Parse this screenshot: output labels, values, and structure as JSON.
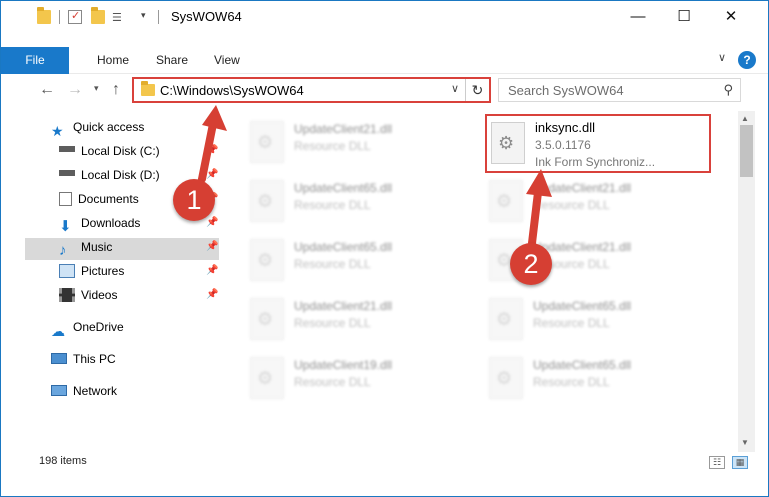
{
  "window": {
    "title": "SysWOW64",
    "minimize": "—",
    "maximize": "☐",
    "close": "✕"
  },
  "ribbon": {
    "tabs": [
      "File",
      "Home",
      "Share",
      "View"
    ],
    "help": "?"
  },
  "address": {
    "path": "C:\\Windows\\SysWOW64",
    "search_placeholder": "Search SysWOW64"
  },
  "nav": {
    "items": [
      {
        "label": "Quick access",
        "icon": "star-icon",
        "pinned": false
      },
      {
        "label": "Local Disk (C:)",
        "icon": "drive-icon",
        "pinned": true
      },
      {
        "label": "Local Disk (D:)",
        "icon": "drive-icon",
        "pinned": true
      },
      {
        "label": "Documents",
        "icon": "documents-icon",
        "pinned": true
      },
      {
        "label": "Downloads",
        "icon": "download-icon",
        "pinned": true
      },
      {
        "label": "Music",
        "icon": "music-icon",
        "pinned": true
      },
      {
        "label": "Pictures",
        "icon": "pictures-icon",
        "pinned": true
      },
      {
        "label": "Videos",
        "icon": "videos-icon",
        "pinned": true
      },
      {
        "label": "OneDrive",
        "icon": "cloud-icon",
        "pinned": false
      },
      {
        "label": "This PC",
        "icon": "computer-icon",
        "pinned": false
      },
      {
        "label": "Network",
        "icon": "network-icon",
        "pinned": false
      }
    ],
    "selected": "This PC"
  },
  "files": {
    "left": [
      {
        "name": "UpdateClient21.dll",
        "type": "Resource DLL"
      },
      {
        "name": "UpdateClient65.dll",
        "type": "Resource DLL"
      },
      {
        "name": "UpdateClient65.dll",
        "type": "Resource DLL"
      },
      {
        "name": "UpdateClient21.dll",
        "type": "Resource DLL"
      },
      {
        "name": "UpdateClient19.dll",
        "type": "Resource DLL"
      }
    ],
    "right": [
      {
        "name": "UpdateClient21.dll",
        "type": "Resource DLL"
      },
      {
        "name": "UpdateClient21.dll",
        "type": "Resource DLL"
      },
      {
        "name": "UpdateClient65.dll",
        "type": "Resource DLL"
      },
      {
        "name": "UpdateClient65.dll",
        "type": "Resource DLL"
      }
    ],
    "highlighted": {
      "name": "inksync.dll",
      "version": "3.5.0.1176",
      "description": "Ink Form Synchroniz..."
    }
  },
  "status": {
    "count": "198 items"
  },
  "annotations": {
    "badge1": "1",
    "badge2": "2",
    "color": "#d63f33"
  }
}
